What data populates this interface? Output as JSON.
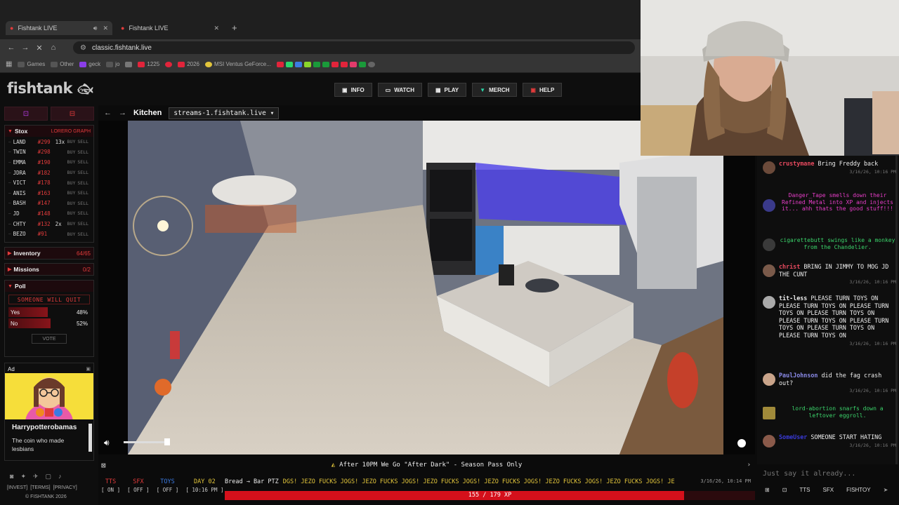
{
  "browser": {
    "tabs": [
      {
        "title": "Fishtank LIVE",
        "active": true
      },
      {
        "title": "Fishtank LIVE",
        "active": false
      }
    ],
    "url": "classic.fishtank.live",
    "bookmarks": [
      "Games",
      "Other",
      "geck",
      "jo",
      "1225",
      "2026",
      "MSI Ventus GeForce..."
    ]
  },
  "site": {
    "logo": "fishtank",
    "nav": [
      {
        "icon": "info-icon",
        "label": "INFO"
      },
      {
        "icon": "watch-icon",
        "label": "WATCH"
      },
      {
        "icon": "play-icon",
        "label": "PLAY"
      },
      {
        "icon": "merch-icon",
        "label": "MERCH"
      },
      {
        "icon": "help-icon",
        "label": "HELP"
      }
    ]
  },
  "stox": {
    "title": "Stox",
    "links": "LORERO  GRAPH",
    "rows": [
      {
        "ticker": "LAND",
        "price": "#299",
        "mult": "13x"
      },
      {
        "ticker": "TWIN",
        "price": "#298",
        "mult": ""
      },
      {
        "ticker": "EMMA",
        "price": "#190",
        "mult": ""
      },
      {
        "ticker": "JDRA",
        "price": "#182",
        "mult": ""
      },
      {
        "ticker": "VICT",
        "price": "#178",
        "mult": ""
      },
      {
        "ticker": "ANIS",
        "price": "#163",
        "mult": ""
      },
      {
        "ticker": "BASH",
        "price": "#147",
        "mult": ""
      },
      {
        "ticker": "JD",
        "price": "#148",
        "mult": ""
      },
      {
        "ticker": "CHTY",
        "price": "#132",
        "mult": "2x"
      },
      {
        "ticker": "BEZO",
        "price": "#91",
        "mult": ""
      }
    ],
    "buy_label": "BUY",
    "sell_label": "SELL"
  },
  "inventory": {
    "label": "Inventory",
    "count": "64/65"
  },
  "missions": {
    "label": "Missions",
    "count": "0/2"
  },
  "poll": {
    "label": "Poll",
    "question": "SOMEONE WILL QUIT",
    "options": [
      {
        "label": "Yes",
        "pct": "48%",
        "fraction": 0.48
      },
      {
        "label": "No",
        "pct": "52%",
        "fraction": 0.52
      }
    ],
    "vote_label": "VOTE"
  },
  "ad": {
    "label": "Ad",
    "title": "Harrypotterobamas",
    "text": "The coin who made lesbians"
  },
  "footer": {
    "links": [
      "INVEST",
      "TERMS",
      "PRIVACY"
    ],
    "copyright": "© FISHTANK 2026"
  },
  "stream": {
    "room": "Kitchen",
    "source": "streams-1.fishtank.live",
    "volume": 0.75
  },
  "banner": "After 10PM We Go \"After Dark\" - Season Pass Only",
  "toggles": [
    {
      "label": "TTS",
      "state": "[ ON ]",
      "color": "#e23b3b"
    },
    {
      "label": "SFX",
      "state": "[ OFF ]",
      "color": "#e23b3b"
    },
    {
      "label": "TOYS",
      "state": "[ OFF ]",
      "color": "#3b7be2"
    },
    {
      "label": "DAY 02",
      "state": "[ 10:16 PM ]",
      "color": "#e2c53b"
    }
  ],
  "ticker": {
    "prefix": "Bread → Bar PTZ",
    "text": "DGS! JEZO FUCKS JOGS! JEZO FUCKS JOGS! JEZO FUCKS JOGS! JEZO FUCKS JOGS! JEZO FUCKS JOGS! JEZO FUCKS JOGS! JE",
    "timestamp": "3/16/26, 10:14 PM"
  },
  "xp": {
    "text": "155 / 179 XP",
    "fraction": 0.866
  },
  "chat": {
    "messages": [
      {
        "user": "crustymane",
        "text": "Bring Freddy back",
        "ts": "3/16/26, 10:16 PM",
        "type": "msg"
      },
      {
        "user": "Danger_Tape",
        "text": "smells down their Refined Metal into XP and injects it... ahh thats the good stuff!!!",
        "ts": "",
        "type": "action",
        "color": "#e83ec9"
      },
      {
        "user": "cigarettebutt",
        "text": "swings like a monkey from the Chandelier.",
        "ts": "",
        "type": "action",
        "color": "#3bd46b"
      },
      {
        "user": "christ",
        "text": "BRING IN JIMMY TO MOG JD THE CUNT",
        "ts": "3/16/26, 10:16 PM",
        "type": "msg"
      },
      {
        "user": "tit-less",
        "text": "PLEASE TURN TOYS ON PLEASE TURN TOYS ON PLEASE TURN TOYS ON PLEASE TURN TOYS ON PLEASE TURN TOYS ON PLEASE TURN TOYS ON PLEASE TURN TOYS ON PLEASE TURN TOYS ON",
        "ts": "3/16/26, 10:16 PM",
        "type": "msg"
      },
      {
        "user": "PaulJohnson",
        "text": "did the fag crash out?",
        "ts": "3/16/26, 10:16 PM",
        "type": "msg"
      },
      {
        "user": "lord-abortion",
        "text": "snarfs down a leftover eggroll.",
        "ts": "",
        "type": "action",
        "color": "#3bd46b"
      },
      {
        "user": "SomeUser",
        "text": "SOMEONE START HATING",
        "ts": "3/16/26, 10:16 PM",
        "type": "msg"
      }
    ],
    "input_placeholder": "Just say it already...",
    "buttons": [
      "TTS",
      "SFX",
      "FISHTOY"
    ]
  }
}
